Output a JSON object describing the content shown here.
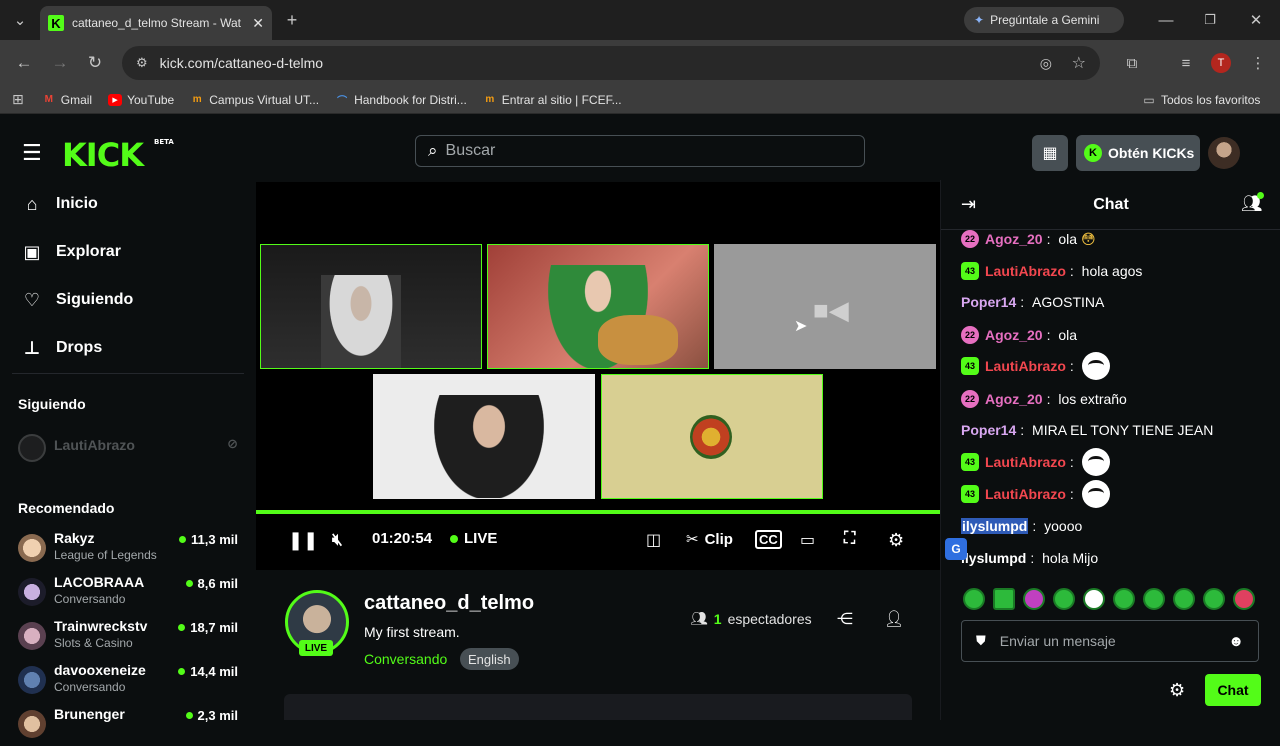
{
  "browser": {
    "tab_title": "cattaneo_d_telmo Stream - Wat",
    "gemini_label": "Pregúntale a Gemini",
    "url": "kick.com/cattaneo-d-telmo",
    "profile_initial": "T",
    "bookmarks": [
      {
        "label": "Gmail"
      },
      {
        "label": "YouTube"
      },
      {
        "label": "Campus Virtual UT..."
      },
      {
        "label": "Handbook for Distri..."
      },
      {
        "label": "Entrar al sitio | FCEF..."
      }
    ],
    "all_bookmarks_label": "Todos los favoritos"
  },
  "header": {
    "logo_text": "KICK",
    "logo_badge": "BETA",
    "search_placeholder": "Buscar",
    "kicks_label": "Obtén KICKs"
  },
  "sidebar": {
    "nav": [
      {
        "label": "Inicio"
      },
      {
        "label": "Explorar"
      },
      {
        "label": "Siguiendo"
      },
      {
        "label": "Drops"
      }
    ],
    "following_heading": "Siguiendo",
    "following": [
      {
        "name": "LautiAbrazo"
      }
    ],
    "recommended_heading": "Recomendado",
    "recommended": [
      {
        "name": "Rakyz",
        "category": "League of Legends",
        "viewers": "11,3 mil"
      },
      {
        "name": "LACOBRAAA",
        "category": "Conversando",
        "viewers": "8,6 mil"
      },
      {
        "name": "Trainwreckstv",
        "category": "Slots & Casino",
        "viewers": "18,7 mil"
      },
      {
        "name": "davooxeneize",
        "category": "Conversando",
        "viewers": "14,4 mil"
      },
      {
        "name": "Brunenger",
        "category": "",
        "viewers": "2,3 mil"
      }
    ]
  },
  "player": {
    "time": "01:20:54",
    "live_label": "LIVE",
    "clip_label": "Clip"
  },
  "channel": {
    "name": "cattaneo_d_telmo",
    "live_badge": "LIVE",
    "stream_title": "My first stream.",
    "category": "Conversando",
    "language": "English",
    "viewer_count": "1",
    "viewer_label": "espectadores"
  },
  "chat": {
    "title": "Chat",
    "messages": [
      {
        "badge": "22",
        "user": "Agoz_20",
        "text": "ola"
      },
      {
        "badge": "43",
        "user": "LautiAbrazo",
        "text": "hola agos"
      },
      {
        "badge": "",
        "user": "Poper14",
        "text": "AGOSTINA"
      },
      {
        "badge": "22",
        "user": "Agoz_20",
        "text": "ola"
      },
      {
        "badge": "43",
        "user": "LautiAbrazo",
        "text": ""
      },
      {
        "badge": "22",
        "user": "Agoz_20",
        "text": "los extraño"
      },
      {
        "badge": "",
        "user": "Poper14",
        "text": "MIRA EL TONY TIENE JEAN"
      },
      {
        "badge": "43",
        "user": "LautiAbrazo",
        "text": ""
      },
      {
        "badge": "43",
        "user": "LautiAbrazo",
        "text": ""
      },
      {
        "badge": "",
        "user": "ilyslumpd",
        "text": "yoooo"
      },
      {
        "badge": "",
        "user": "ilyslumpd",
        "text": "hola Mijo"
      }
    ],
    "input_placeholder": "Enviar un mensaje",
    "send_label": "Chat"
  },
  "colors": {
    "brand": "#53fc18",
    "background": "#0b0e0f"
  }
}
